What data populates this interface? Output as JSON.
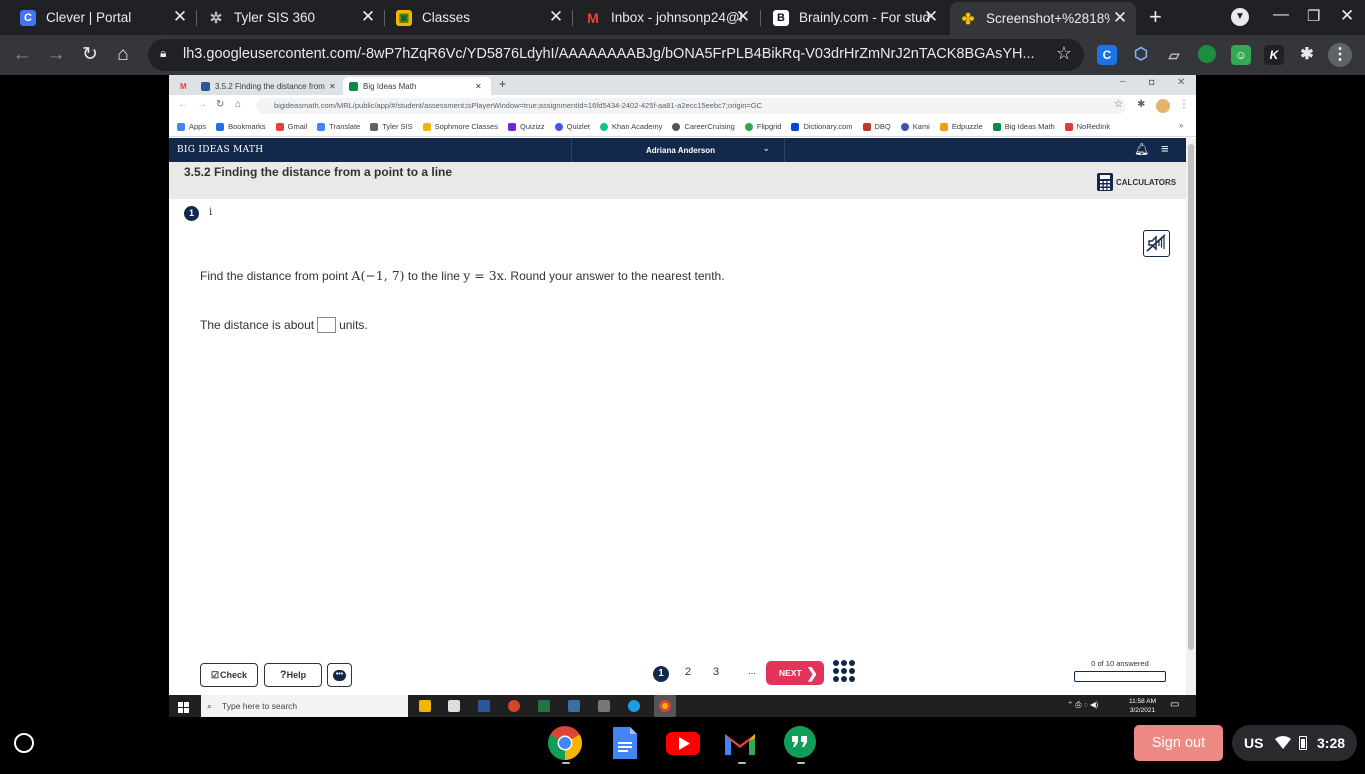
{
  "outer_tabs": [
    {
      "title": "Clever | Portal",
      "icon": "clever-icon",
      "color": "#4274f6",
      "glyph": "C"
    },
    {
      "title": "Tyler SIS 360",
      "icon": "tyler-icon",
      "color": "#202124",
      "glyph": "✲"
    },
    {
      "title": "Classes",
      "icon": "classroom-icon",
      "color": "#f4b400",
      "glyph": "▣"
    },
    {
      "title": "Inbox - johnsonp24@l",
      "icon": "gmail-icon",
      "color": "#202124",
      "glyph": "M"
    },
    {
      "title": "Brainly.com - For stud",
      "icon": "brainly-icon",
      "color": "#111111",
      "glyph": "B"
    },
    {
      "title": "Screenshot+%2818%",
      "icon": "photos-icon",
      "color": "#35363a",
      "glyph": "✤"
    }
  ],
  "outer_url": "lh3.googleusercontent.com/-8wP7hZqR6Vc/YD5876LdyhI/AAAAAAAABJg/bONA5FrPLB4BikRq-V03drHrZmNrJ2nTACK8BGAsYH...",
  "inner_tabs": [
    {
      "title": "3.5.2 Finding the distance from a",
      "color": "#2b5797"
    },
    {
      "title": "Big Ideas Math",
      "color": "#0a8a48"
    }
  ],
  "inner_url": "bigideasmath.com/MRL/public/app/#/student/assessment;isPlayerWindow=true;assignmentId=16fd5434-2402-425f-aa81-a2ecc15eebc7;origin=GC",
  "bookmarks": [
    {
      "label": "Apps",
      "color": "#4285f4"
    },
    {
      "label": "Bookmarks",
      "color": "#1a73e8"
    },
    {
      "label": "Gmail",
      "color": "#ea4335"
    },
    {
      "label": "Translate",
      "color": "#4285f4"
    },
    {
      "label": "Tyler SIS",
      "color": "#5f6368"
    },
    {
      "label": "Sophmore Classes",
      "color": "#f4b400"
    },
    {
      "label": "Quizizz",
      "color": "#6d28d9"
    },
    {
      "label": "Quizlet",
      "color": "#4255ff"
    },
    {
      "label": "Khan Academy",
      "color": "#14bf96"
    },
    {
      "label": "CareerCruising",
      "color": "#555555"
    },
    {
      "label": "Flipgrid",
      "color": "#31a84f"
    },
    {
      "label": "Dictionary.com",
      "color": "#0049d7"
    },
    {
      "label": "DBQ",
      "color": "#c0392b"
    },
    {
      "label": "Kami",
      "color": "#3f51b5"
    },
    {
      "label": "Edpuzzle",
      "color": "#f39c12"
    },
    {
      "label": "Big Ideas Math",
      "color": "#0a8a48"
    },
    {
      "label": "NoRedInk",
      "color": "#e53935"
    }
  ],
  "app": {
    "logo": "BIG IDEAS MATH",
    "user": "Adriana Anderson",
    "lesson_title": "3.5.2 Finding the distance from a point to a line",
    "calculators_label": "CALCULATORS",
    "question_number": "1",
    "info_label": "i"
  },
  "question": {
    "prefix": "Find the distance from point",
    "point": "A(−1, 7)",
    "middle": "to the line",
    "line": "y = 3x",
    "suffix": ". Round your answer to the nearest tenth.",
    "answer_prefix": "The distance is about",
    "answer_value": "",
    "answer_suffix": "units."
  },
  "footer": {
    "check_label": "Check",
    "help_label": "Help",
    "pages": [
      "1",
      "2",
      "3",
      "..."
    ],
    "next_label": "NEXT",
    "progress_label": "0 of 10 answered",
    "progress_fraction": 0
  },
  "windows_taskbar": {
    "search_placeholder": "Type here to search",
    "time": "11:58 AM",
    "date": "3/2/2021"
  },
  "shelf": {
    "sign_out": "Sign out",
    "locale": "US",
    "time": "3:28"
  }
}
